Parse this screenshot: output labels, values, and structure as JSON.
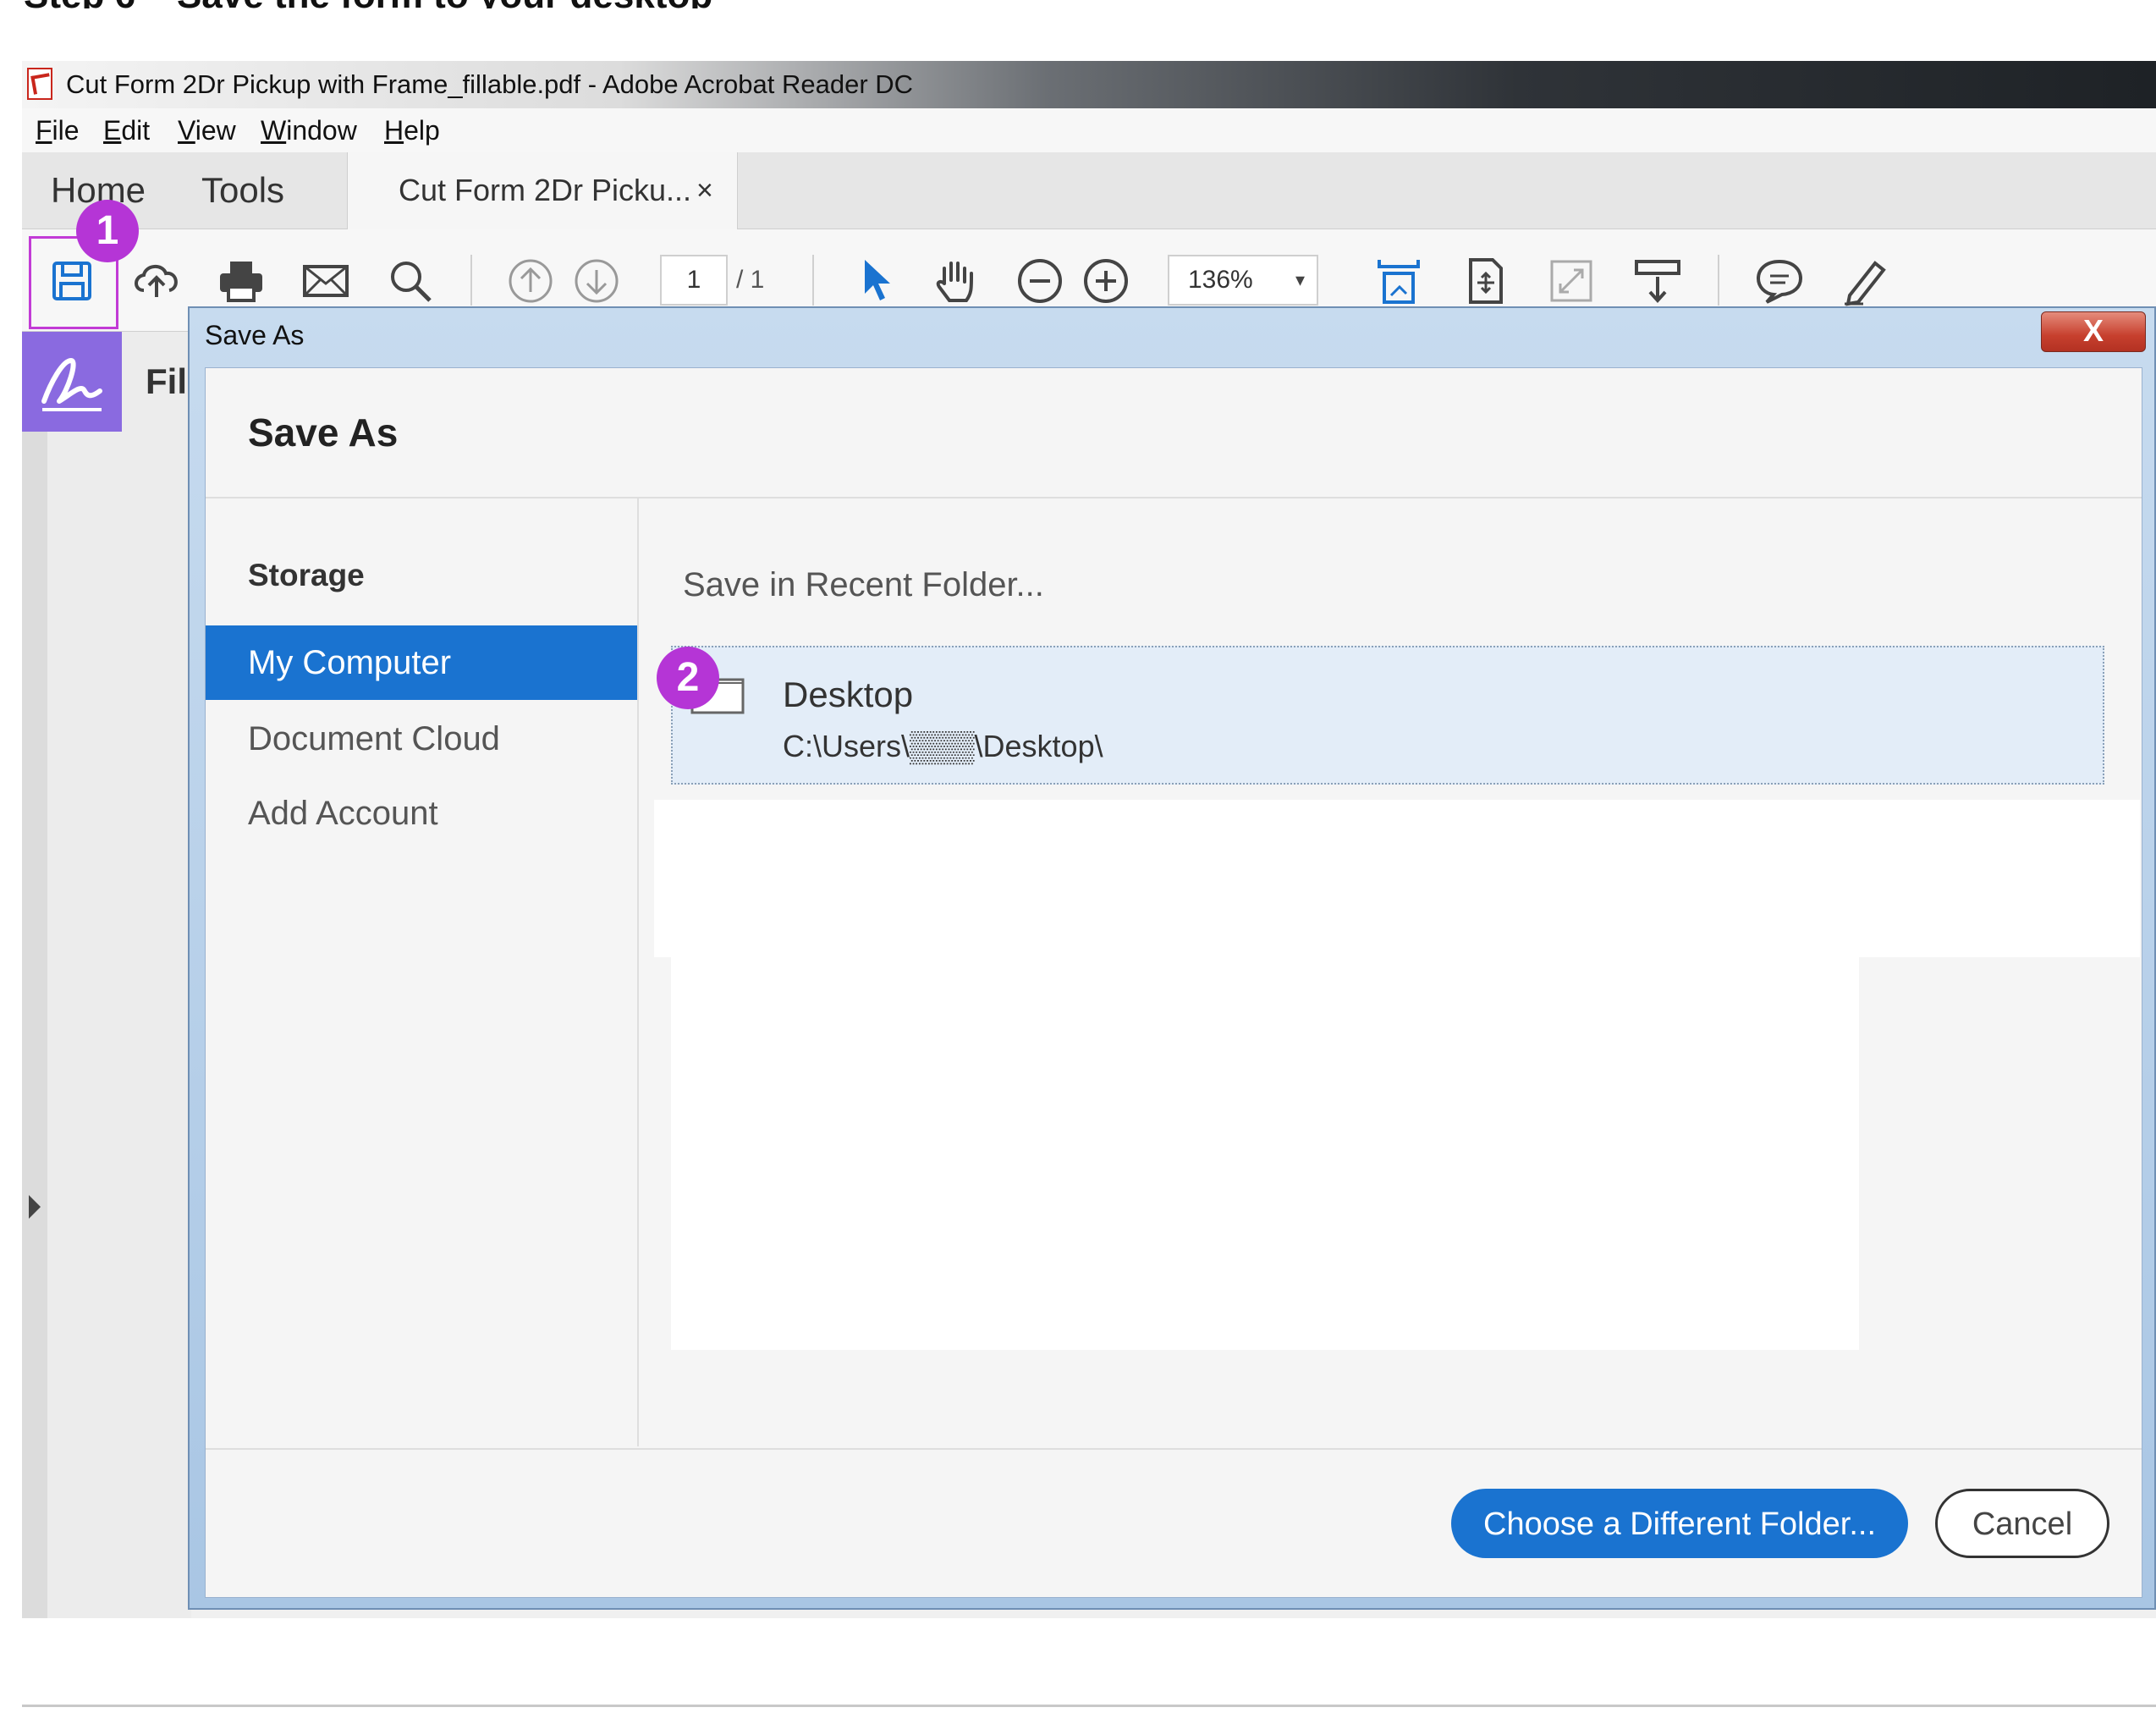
{
  "step_heading": "Step 6 – Save the form to your desktop",
  "window": {
    "title": "Cut Form 2Dr Pickup with Frame_fillable.pdf - Adobe Acrobat Reader DC",
    "menu": [
      {
        "key": "F",
        "rest": "ile"
      },
      {
        "key": "E",
        "rest": "dit"
      },
      {
        "key": "V",
        "rest": "iew"
      },
      {
        "key": "W",
        "rest": "indow"
      },
      {
        "key": "H",
        "rest": "elp"
      }
    ],
    "nav_tabs": [
      "Home",
      "Tools"
    ],
    "doc_tab": {
      "label": "Cut Form 2Dr Picku...",
      "close": "×"
    }
  },
  "toolbar": {
    "page_current": "1",
    "page_total": "/ 1",
    "zoom": "136%",
    "zoom_caret": "▾",
    "icons": [
      "save-icon",
      "upload-icon",
      "print-icon",
      "email-icon",
      "search-icon",
      "page-up-icon",
      "page-down-icon",
      "select-arrow-icon",
      "hand-icon",
      "zoom-out-icon",
      "zoom-in-icon",
      "fit-page-icon",
      "page-display-icon",
      "full-screen-icon",
      "scroll-mode-icon",
      "comment-icon",
      "highlight-pen-icon"
    ]
  },
  "left_panel": {
    "label": "Fil"
  },
  "badges": {
    "one": "1",
    "two": "2"
  },
  "dialog": {
    "title": "Save As",
    "close": "X",
    "heading": "Save As",
    "storage_heading": "Storage",
    "storage_items": [
      "My Computer",
      "Document Cloud",
      "Add Account"
    ],
    "recent_label": "Save in Recent Folder...",
    "folder": {
      "name": "Desktop",
      "path": "C:\\Users\\▒▒▒\\Desktop\\"
    },
    "buttons": {
      "primary": "Choose a Different Folder...",
      "cancel": "Cancel"
    }
  },
  "colors": {
    "accent": "#1a73d0",
    "badge": "#b535d6",
    "fill_sign": "#8a6ae0"
  }
}
